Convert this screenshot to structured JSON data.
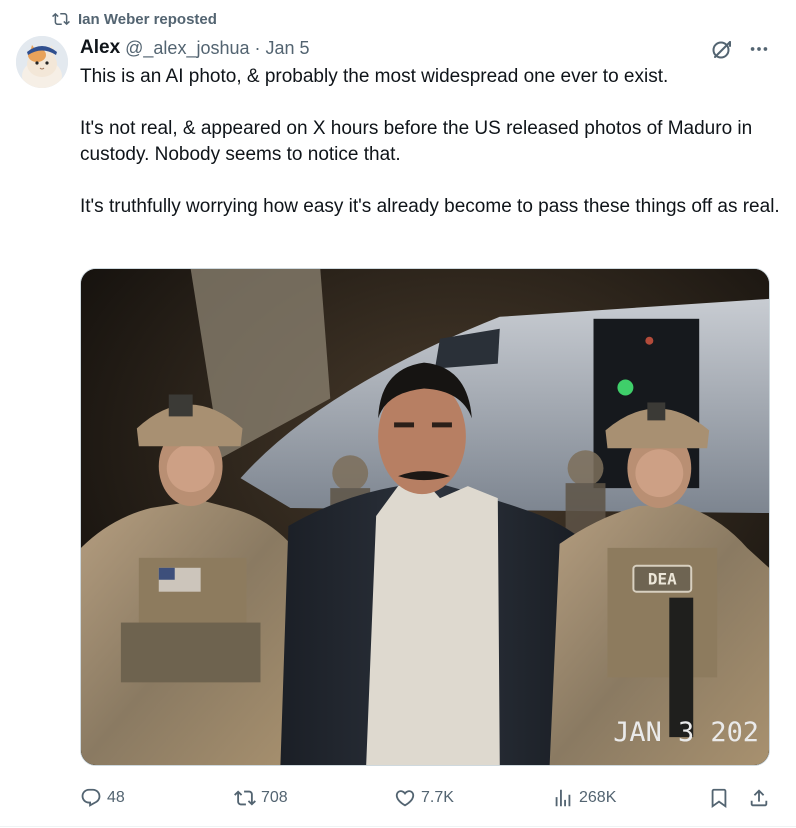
{
  "repost": {
    "label": "Ian Weber reposted",
    "icon": "repost-icon"
  },
  "author": {
    "name": "Alex",
    "handle": "@_alex_joshua",
    "separator": "·",
    "date": "Jan 5",
    "avatar": "cat-avatar"
  },
  "tweet": {
    "paragraphs": [
      "This is an AI photo, & probably the most widespread one ever to exist.",
      "It's not real, & appeared on X hours before the US released photos of Maduro in custody. Nobody seems to notice that.",
      "It's truthfully worrying how easy it's already become to pass these things off as real."
    ]
  },
  "media": {
    "patch_text": "DEA",
    "timestamp": "JAN 3 202"
  },
  "actions": {
    "replies": "48",
    "reposts": "708",
    "likes": "7.7K",
    "views": "268K"
  },
  "colors": {
    "text": "#0f1419",
    "secondary": "#536471",
    "border": "#cfd9de"
  }
}
